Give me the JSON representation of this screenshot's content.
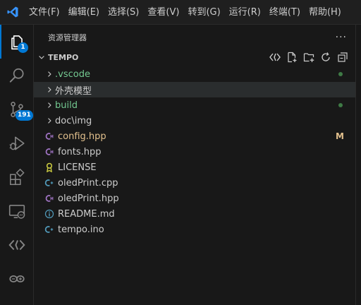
{
  "menu": [
    "文件(F)",
    "编辑(E)",
    "选择(S)",
    "查看(V)",
    "转到(G)",
    "运行(R)",
    "终端(T)",
    "帮助(H)"
  ],
  "activity": {
    "explorer_badge": "1",
    "scm_badge": "191"
  },
  "sidebar": {
    "title": "资源管理器",
    "more": "···",
    "section_title": "TEMPO"
  },
  "tree": [
    {
      "label": ".vscode",
      "type": "folder",
      "color": "#73c991",
      "dot": true
    },
    {
      "label": "外壳模型",
      "type": "folder",
      "color": "#cccccc"
    },
    {
      "label": "build",
      "type": "folder",
      "color": "#73c991",
      "dot": true
    },
    {
      "label": "doc\\img",
      "type": "folder",
      "color": "#cccccc"
    },
    {
      "label": "config.hpp",
      "type": "file",
      "icon": "cpp-header",
      "color": "#e2c08d",
      "decoration": "M"
    },
    {
      "label": "fonts.hpp",
      "type": "file",
      "icon": "cpp-header",
      "color": "#cccccc"
    },
    {
      "label": "LICENSE",
      "type": "file",
      "icon": "license",
      "color": "#cccccc"
    },
    {
      "label": "oledPrint.cpp",
      "type": "file",
      "icon": "cpp",
      "color": "#cccccc"
    },
    {
      "label": "oledPrint.hpp",
      "type": "file",
      "icon": "cpp-header",
      "color": "#cccccc"
    },
    {
      "label": "README.md",
      "type": "file",
      "icon": "info",
      "color": "#cccccc"
    },
    {
      "label": "tempo.ino",
      "type": "file",
      "icon": "arduino",
      "color": "#cccccc"
    }
  ],
  "colors": {
    "accent": "#0078d4",
    "modified": "#e2c08d",
    "untracked": "#73c991"
  }
}
